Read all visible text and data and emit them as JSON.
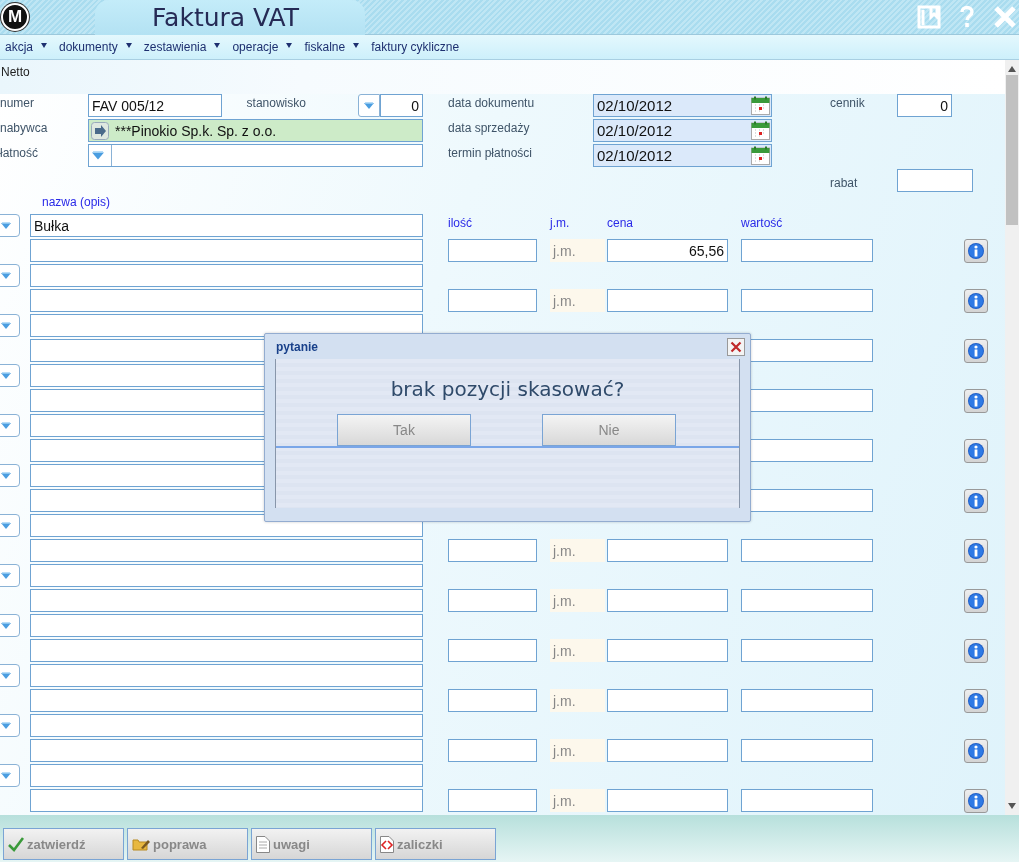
{
  "window": {
    "logo": "M",
    "title": "Faktura VAT"
  },
  "menu": [
    {
      "label": "akcja",
      "has_dropdown": true
    },
    {
      "label": "dokumenty",
      "has_dropdown": true
    },
    {
      "label": "zestawienia",
      "has_dropdown": true
    },
    {
      "label": "operacje",
      "has_dropdown": true
    },
    {
      "label": "fiskalne",
      "has_dropdown": true
    },
    {
      "label": "faktury cykliczne",
      "has_dropdown": false
    }
  ],
  "tab": "Netto",
  "header": {
    "number": {
      "label": "numer",
      "value": "FAV 005/12"
    },
    "station": {
      "label": "stanowisko",
      "value": "0"
    },
    "buyer": {
      "label": "nabywca",
      "value": "***Pinokio Sp.k. Sp. z o.o."
    },
    "payment": {
      "label": "łatność"
    },
    "dates": [
      {
        "label": "data dokumentu",
        "value": "02/10/2012"
      },
      {
        "label": "data sprzedaży",
        "value": "02/10/2012"
      },
      {
        "label": "termin płatności",
        "value": "02/10/2012"
      }
    ],
    "price_list": {
      "label": "cennik",
      "value": "0"
    },
    "discount": {
      "label": "rabat"
    }
  },
  "items": {
    "name_label": "nazwa (opis)",
    "columns": [
      "ilość",
      "j.m.",
      "cena",
      "wartość"
    ],
    "rows": [
      {
        "name": "Bułka",
        "unit": "j.m.",
        "price": "65,56"
      },
      {
        "unit": "j.m."
      },
      {},
      {},
      {},
      {},
      {
        "unit": "j.m."
      },
      {
        "unit": "j.m."
      },
      {
        "unit": "j.m."
      },
      {
        "unit": "j.m."
      },
      {
        "unit": "j.m."
      },
      {
        "unit": "j.m."
      }
    ]
  },
  "dialog": {
    "title": "pytanie",
    "message": "brak pozycji skasować?",
    "buttons": [
      "Tak",
      "Nie"
    ]
  },
  "footer": [
    {
      "label": "zatwierdź",
      "kind": "confirm"
    },
    {
      "label": "poprawa",
      "kind": "edit"
    },
    {
      "label": "uwagi",
      "kind": "notes"
    },
    {
      "label": "zaliczki",
      "kind": "advances"
    }
  ]
}
